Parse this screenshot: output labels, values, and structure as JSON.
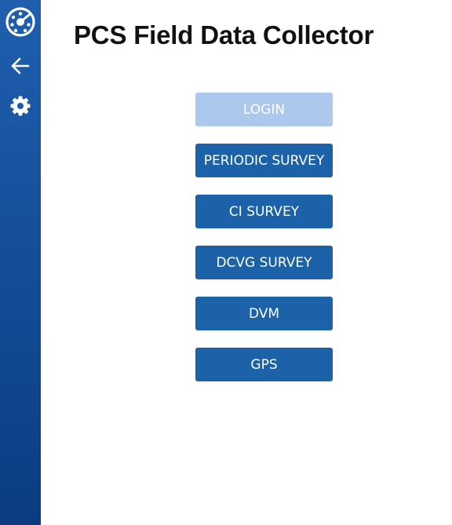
{
  "header": {
    "title": "PCS Field Data Collector"
  },
  "sidebar": {
    "items": [
      {
        "icon": "dashboard-icon"
      },
      {
        "icon": "back-arrow-icon"
      },
      {
        "icon": "gear-icon"
      }
    ]
  },
  "menu": {
    "login": "LOGIN",
    "periodic_survey": "PERIODIC SURVEY",
    "ci_survey": "CI SURVEY",
    "dcvg_survey": "DCVG SURVEY",
    "dvm": "DVM",
    "gps": "GPS"
  },
  "colors": {
    "sidebar_top": "#1f5fae",
    "sidebar_bottom": "#0b3c80",
    "button": "#1b62a8",
    "button_disabled": "#adc8ed",
    "title_text": "#111111"
  }
}
